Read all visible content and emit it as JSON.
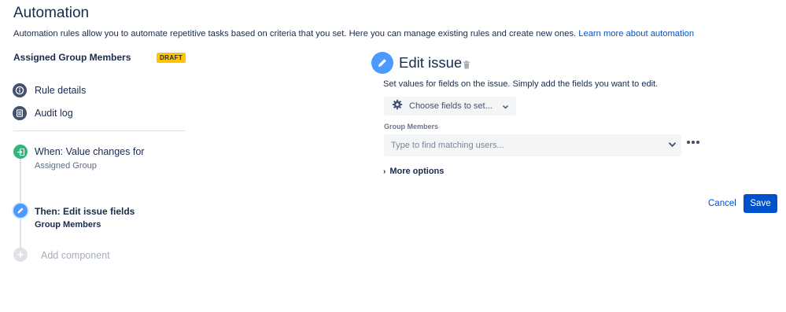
{
  "header": {
    "title": "Automation",
    "description": "Automation rules allow you to automate repetitive tasks based on criteria that you set. Here you can manage existing rules and create new ones.",
    "learn_more": "Learn more about automation"
  },
  "rule": {
    "name": "Assigned Group Members",
    "badge": "DRAFT"
  },
  "nav": {
    "rule_details": "Rule details",
    "audit_log": "Audit log"
  },
  "steps": {
    "when_title": "When: Value changes for",
    "when_sub": "Assigned Group",
    "then_title": "Then: Edit issue fields",
    "then_sub": "Group Members",
    "add_component": "Add component"
  },
  "editor": {
    "title": "Edit issue",
    "description": "Set values for fields on the issue. Simply add the fields you want to edit.",
    "choose_fields": "Choose fields to set...",
    "field_label": "Group Members",
    "field_placeholder": "Type to find matching users...",
    "more_options": "More options",
    "cancel": "Cancel",
    "save": "Save"
  },
  "colors": {
    "primary": "#0052cc",
    "draft_badge": "#ffc400",
    "when_step": "#36b37e",
    "then_step": "#4c9aff"
  }
}
